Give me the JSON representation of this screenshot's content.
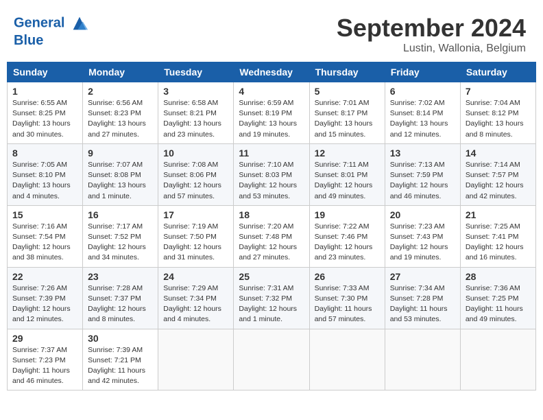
{
  "header": {
    "logo_line1": "General",
    "logo_line2": "Blue",
    "month_title": "September 2024",
    "location": "Lustin, Wallonia, Belgium"
  },
  "days_of_week": [
    "Sunday",
    "Monday",
    "Tuesday",
    "Wednesday",
    "Thursday",
    "Friday",
    "Saturday"
  ],
  "weeks": [
    [
      {
        "day": "1",
        "content": "Sunrise: 6:55 AM\nSunset: 8:25 PM\nDaylight: 13 hours\nand 30 minutes."
      },
      {
        "day": "2",
        "content": "Sunrise: 6:56 AM\nSunset: 8:23 PM\nDaylight: 13 hours\nand 27 minutes."
      },
      {
        "day": "3",
        "content": "Sunrise: 6:58 AM\nSunset: 8:21 PM\nDaylight: 13 hours\nand 23 minutes."
      },
      {
        "day": "4",
        "content": "Sunrise: 6:59 AM\nSunset: 8:19 PM\nDaylight: 13 hours\nand 19 minutes."
      },
      {
        "day": "5",
        "content": "Sunrise: 7:01 AM\nSunset: 8:17 PM\nDaylight: 13 hours\nand 15 minutes."
      },
      {
        "day": "6",
        "content": "Sunrise: 7:02 AM\nSunset: 8:14 PM\nDaylight: 13 hours\nand 12 minutes."
      },
      {
        "day": "7",
        "content": "Sunrise: 7:04 AM\nSunset: 8:12 PM\nDaylight: 13 hours\nand 8 minutes."
      }
    ],
    [
      {
        "day": "8",
        "content": "Sunrise: 7:05 AM\nSunset: 8:10 PM\nDaylight: 13 hours\nand 4 minutes."
      },
      {
        "day": "9",
        "content": "Sunrise: 7:07 AM\nSunset: 8:08 PM\nDaylight: 13 hours\nand 1 minute."
      },
      {
        "day": "10",
        "content": "Sunrise: 7:08 AM\nSunset: 8:06 PM\nDaylight: 12 hours\nand 57 minutes."
      },
      {
        "day": "11",
        "content": "Sunrise: 7:10 AM\nSunset: 8:03 PM\nDaylight: 12 hours\nand 53 minutes."
      },
      {
        "day": "12",
        "content": "Sunrise: 7:11 AM\nSunset: 8:01 PM\nDaylight: 12 hours\nand 49 minutes."
      },
      {
        "day": "13",
        "content": "Sunrise: 7:13 AM\nSunset: 7:59 PM\nDaylight: 12 hours\nand 46 minutes."
      },
      {
        "day": "14",
        "content": "Sunrise: 7:14 AM\nSunset: 7:57 PM\nDaylight: 12 hours\nand 42 minutes."
      }
    ],
    [
      {
        "day": "15",
        "content": "Sunrise: 7:16 AM\nSunset: 7:54 PM\nDaylight: 12 hours\nand 38 minutes."
      },
      {
        "day": "16",
        "content": "Sunrise: 7:17 AM\nSunset: 7:52 PM\nDaylight: 12 hours\nand 34 minutes."
      },
      {
        "day": "17",
        "content": "Sunrise: 7:19 AM\nSunset: 7:50 PM\nDaylight: 12 hours\nand 31 minutes."
      },
      {
        "day": "18",
        "content": "Sunrise: 7:20 AM\nSunset: 7:48 PM\nDaylight: 12 hours\nand 27 minutes."
      },
      {
        "day": "19",
        "content": "Sunrise: 7:22 AM\nSunset: 7:46 PM\nDaylight: 12 hours\nand 23 minutes."
      },
      {
        "day": "20",
        "content": "Sunrise: 7:23 AM\nSunset: 7:43 PM\nDaylight: 12 hours\nand 19 minutes."
      },
      {
        "day": "21",
        "content": "Sunrise: 7:25 AM\nSunset: 7:41 PM\nDaylight: 12 hours\nand 16 minutes."
      }
    ],
    [
      {
        "day": "22",
        "content": "Sunrise: 7:26 AM\nSunset: 7:39 PM\nDaylight: 12 hours\nand 12 minutes."
      },
      {
        "day": "23",
        "content": "Sunrise: 7:28 AM\nSunset: 7:37 PM\nDaylight: 12 hours\nand 8 minutes."
      },
      {
        "day": "24",
        "content": "Sunrise: 7:29 AM\nSunset: 7:34 PM\nDaylight: 12 hours\nand 4 minutes."
      },
      {
        "day": "25",
        "content": "Sunrise: 7:31 AM\nSunset: 7:32 PM\nDaylight: 12 hours\nand 1 minute."
      },
      {
        "day": "26",
        "content": "Sunrise: 7:33 AM\nSunset: 7:30 PM\nDaylight: 11 hours\nand 57 minutes."
      },
      {
        "day": "27",
        "content": "Sunrise: 7:34 AM\nSunset: 7:28 PM\nDaylight: 11 hours\nand 53 minutes."
      },
      {
        "day": "28",
        "content": "Sunrise: 7:36 AM\nSunset: 7:25 PM\nDaylight: 11 hours\nand 49 minutes."
      }
    ],
    [
      {
        "day": "29",
        "content": "Sunrise: 7:37 AM\nSunset: 7:23 PM\nDaylight: 11 hours\nand 46 minutes."
      },
      {
        "day": "30",
        "content": "Sunrise: 7:39 AM\nSunset: 7:21 PM\nDaylight: 11 hours\nand 42 minutes."
      },
      {
        "day": "",
        "content": ""
      },
      {
        "day": "",
        "content": ""
      },
      {
        "day": "",
        "content": ""
      },
      {
        "day": "",
        "content": ""
      },
      {
        "day": "",
        "content": ""
      }
    ]
  ]
}
